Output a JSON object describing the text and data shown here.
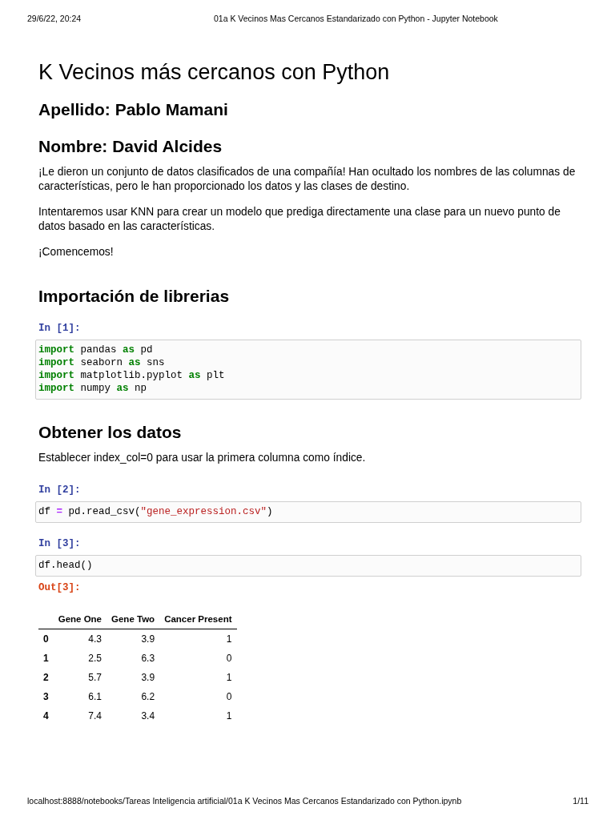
{
  "header": {
    "date": "29/6/22, 20:24",
    "title": "01a K Vecinos Mas Cercanos Estandarizado con Python - Jupyter Notebook"
  },
  "cells": [
    {
      "kind": "h1",
      "text": "K Vecinos más cercanos con Python"
    },
    {
      "kind": "h2",
      "text": "Apellido: Pablo Mamani"
    },
    {
      "kind": "h2",
      "text": "Nombre: David Alcides"
    },
    {
      "kind": "p",
      "text": "¡Le dieron un conjunto de datos clasificados de una compañía! Han ocultado los nombres de las columnas de características, pero le han proporcionado los datos y las clases de destino."
    },
    {
      "kind": "p",
      "text": "Intentaremos usar KNN para crear un modelo que prediga directamente una clase para un nuevo punto de datos basado en las características."
    },
    {
      "kind": "p",
      "text": "¡Comencemos!"
    },
    {
      "kind": "h2",
      "text": "Importación de librerias"
    },
    {
      "kind": "code",
      "prompt": "In [1]:",
      "lines": [
        [
          {
            "kind": "keyword",
            "text": "import"
          },
          {
            "kind": "plain",
            "text": " pandas "
          },
          {
            "kind": "keyword",
            "text": "as"
          },
          {
            "kind": "plain",
            "text": " pd"
          }
        ],
        [
          {
            "kind": "keyword",
            "text": "import"
          },
          {
            "kind": "plain",
            "text": " seaborn "
          },
          {
            "kind": "keyword",
            "text": "as"
          },
          {
            "kind": "plain",
            "text": " sns"
          }
        ],
        [
          {
            "kind": "keyword",
            "text": "import"
          },
          {
            "kind": "plain",
            "text": " matplotlib.pyplot "
          },
          {
            "kind": "keyword",
            "text": "as"
          },
          {
            "kind": "plain",
            "text": " plt"
          }
        ],
        [
          {
            "kind": "keyword",
            "text": "import"
          },
          {
            "kind": "plain",
            "text": " numpy "
          },
          {
            "kind": "keyword",
            "text": "as"
          },
          {
            "kind": "plain",
            "text": " np"
          }
        ]
      ]
    },
    {
      "kind": "h2",
      "text": "Obtener los datos"
    },
    {
      "kind": "p",
      "text": "Establecer index_col=0 para usar la primera columna como índice."
    },
    {
      "kind": "code",
      "prompt": "In [2]:",
      "lines": [
        [
          {
            "kind": "plain",
            "text": "df "
          },
          {
            "kind": "operator",
            "text": "="
          },
          {
            "kind": "plain",
            "text": " pd.read_csv("
          },
          {
            "kind": "string",
            "text": "\"gene_expression.csv\""
          },
          {
            "kind": "plain",
            "text": ")"
          }
        ]
      ]
    },
    {
      "kind": "code",
      "prompt": "In [3]:",
      "lines": [
        [
          {
            "kind": "plain",
            "text": "df.head()"
          }
        ]
      ]
    },
    {
      "kind": "output",
      "prompt": "Out[3]:",
      "table": {
        "columns": [
          "Gene One",
          "Gene Two",
          "Cancer Present"
        ],
        "rows": [
          {
            "index": "0",
            "cells": [
              "4.3",
              "3.9",
              "1"
            ]
          },
          {
            "index": "1",
            "cells": [
              "2.5",
              "6.3",
              "0"
            ]
          },
          {
            "index": "2",
            "cells": [
              "5.7",
              "3.9",
              "1"
            ]
          },
          {
            "index": "3",
            "cells": [
              "6.1",
              "6.2",
              "0"
            ]
          },
          {
            "index": "4",
            "cells": [
              "7.4",
              "3.4",
              "1"
            ]
          }
        ]
      }
    }
  ],
  "footer": {
    "url": "localhost:8888/notebooks/Tareas Inteligencia artificial/01a K Vecinos Mas Cercanos Estandarizado con Python.ipynb",
    "page": "1/11"
  }
}
